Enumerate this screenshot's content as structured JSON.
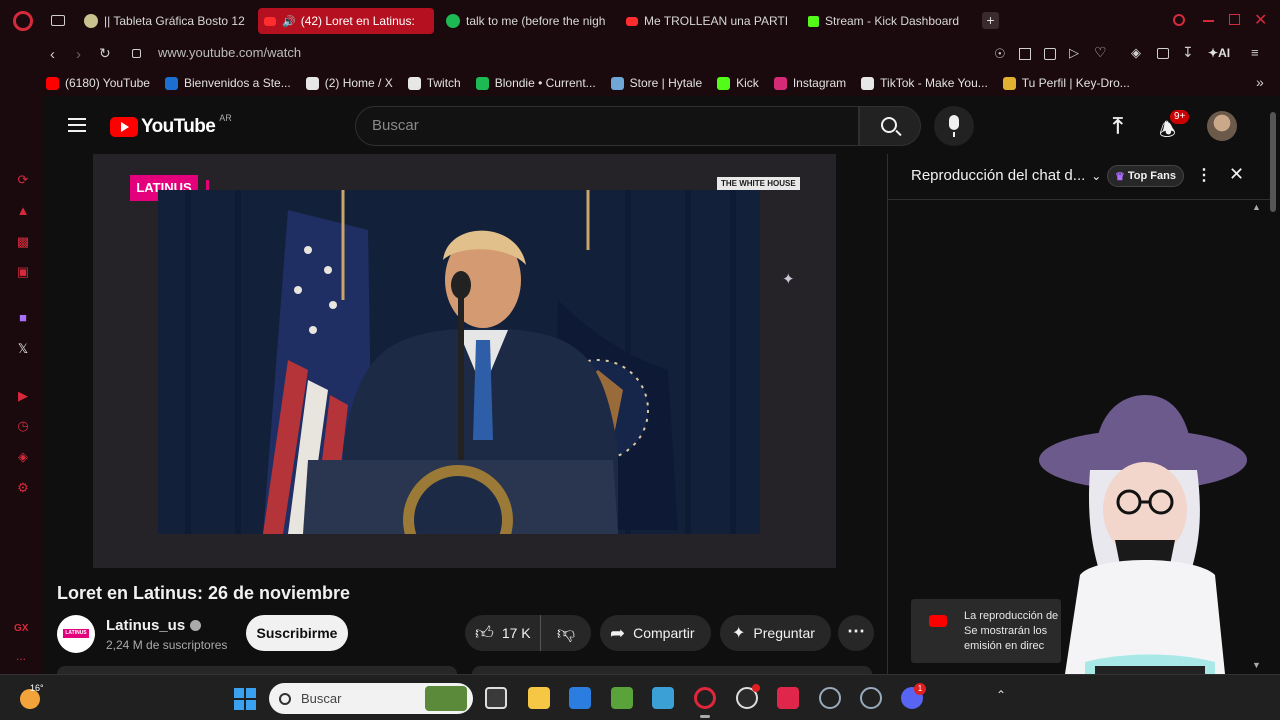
{
  "browser": {
    "tabs": [
      {
        "label": "|| Tableta Gráfica Bosto 12"
      },
      {
        "label": "(42) Loret en Latinus:"
      },
      {
        "label": "talk to me (before the nigh"
      },
      {
        "label": "Me TROLLEAN una PARTI"
      },
      {
        "label": "Stream - Kick Dashboard"
      }
    ],
    "new_tab": "+",
    "url": "www.youtube.com/watch",
    "ai_label": "AI",
    "bookmarks": [
      {
        "label": "(6180) YouTube",
        "color": "#ff0000"
      },
      {
        "label": "Bienvenidos a Ste...",
        "color": "#1b6fd1"
      },
      {
        "label": "(2) Home / X",
        "color": "#e7e7e7"
      },
      {
        "label": "Twitch",
        "color": "#e7e7e7"
      },
      {
        "label": "Blondie • Current...",
        "color": "#1db954"
      },
      {
        "label": "Store | Hytale",
        "color": "#6fa6d6"
      },
      {
        "label": "Kick",
        "color": "#53fc18"
      },
      {
        "label": "Instagram",
        "color": "#d62976"
      },
      {
        "label": "TikTok - Make You...",
        "color": "#e7e7e7"
      },
      {
        "label": "Tu Perfil | Key-Dro...",
        "color": "#e0b030"
      }
    ],
    "sidebar_gx": "GX",
    "sidebar_more": "..."
  },
  "youtube": {
    "logo_text": "YouTube",
    "region": "AR",
    "search_placeholder": "Buscar",
    "notifications_badge": "9+",
    "video": {
      "channel_tag": "LATINUS",
      "watermark": "THE WHITE HOUSE",
      "title": "Loret en Latinus: 26 de noviembre"
    },
    "channel": {
      "name": "Latinus_us",
      "subscribers": "2,24 M de suscriptores",
      "subscribe_label": "Suscribirme",
      "avatar_text": "LATINUS"
    },
    "actions": {
      "likes": "17 K",
      "share": "Compartir",
      "ask": "Preguntar"
    },
    "chat": {
      "title": "Reproducción del chat d...",
      "filter": "Top Fans",
      "notice_line1": "La reproducción de",
      "notice_line2": "Se mostrarán los",
      "notice_line3": "emisión en direc"
    }
  },
  "taskbar": {
    "weather": "16°",
    "search_placeholder": "Buscar",
    "discord_badge": "1"
  },
  "colors": {
    "opera_red": "#d52a3c",
    "youtube_red": "#ff0000",
    "active_tab": "#b4101f",
    "latinus_pink": "#e4007c"
  }
}
